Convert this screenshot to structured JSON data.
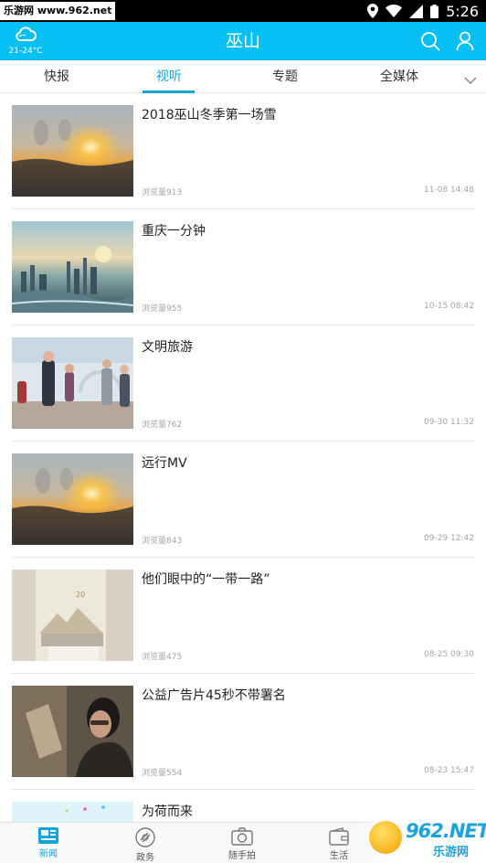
{
  "statusbar": {
    "watermark": "乐游网 www.962.net",
    "time": "5:26",
    "icons": [
      "location-icon",
      "wifi-icon",
      "signal-icon",
      "battery-icon"
    ]
  },
  "header": {
    "title": "巫山",
    "weather_temp": "21-24°C",
    "icons": [
      "cloud-icon",
      "search-icon",
      "user-icon"
    ],
    "accent": "#06bff3"
  },
  "tabs": [
    {
      "label": "快报",
      "active": false
    },
    {
      "label": "视听",
      "active": true
    },
    {
      "label": "专题",
      "active": false
    },
    {
      "label": "全媒体",
      "active": false
    }
  ],
  "tab_accent": "#10a6dc",
  "items": [
    {
      "title": "2018巫山冬季第一场雪",
      "views": "浏览量913",
      "date": "11-08 14:48",
      "thumb": "sunset"
    },
    {
      "title": "重庆一分钟",
      "views": "浏览量955",
      "date": "10-15 08:42",
      "thumb": "city"
    },
    {
      "title": "文明旅游",
      "views": "浏览量762",
      "date": "09-30 11:32",
      "thumb": "people"
    },
    {
      "title": "远行MV",
      "views": "浏览量843",
      "date": "09-29 12:42",
      "thumb": "sunset"
    },
    {
      "title": "他们眼中的“一带一路”",
      "views": "浏览量475",
      "date": "08-25 09:30",
      "thumb": "building"
    },
    {
      "title": "公益广告片45秒不带署名",
      "views": "浏览量554",
      "date": "08-23 15:47",
      "thumb": "portrait"
    },
    {
      "title": "为荷而来",
      "views": "",
      "date": "",
      "thumb": "lotus"
    }
  ],
  "bottom_nav": [
    {
      "label": "新闻",
      "icon": "news-icon",
      "active": true
    },
    {
      "label": "政务",
      "icon": "gov-icon",
      "active": false
    },
    {
      "label": "随手拍",
      "icon": "camera-icon",
      "active": false
    },
    {
      "label": "生活",
      "icon": "wallet-icon",
      "active": false
    },
    {
      "label": "",
      "icon": "",
      "active": false
    }
  ],
  "watermark_bottom": {
    "main": "962.NET",
    "sub": "乐游网"
  }
}
